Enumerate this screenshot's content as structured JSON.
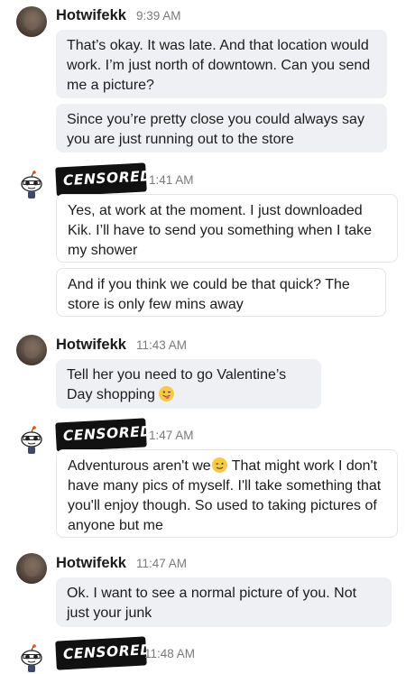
{
  "messages": [
    {
      "sender": "Hotwifekk",
      "time": "9:39 AM",
      "bubbles": [
        "That’s okay. It was late. And that location would work. I’m just north of downtown. Can you send me a picture?",
        "Since you’re pretty close you could always say you are just running out to the store"
      ]
    },
    {
      "sender": "CENSORED",
      "time": "1:41 AM",
      "bubbles": [
        "Yes, at work at the moment. I just downloaded Kik. I’ll have to send you something when I take my shower",
        "And if you think we could be that quick? The store is only few mins away"
      ]
    },
    {
      "sender": "Hotwifekk",
      "time": "11:43 AM",
      "bubbles": [
        "Tell her you need to go Valentine’s Day shopping"
      ]
    },
    {
      "sender": "CENSORED",
      "time": "1:47 AM",
      "bubbles": [
        "Adventurous aren't we",
        "That might work I don't have many pics of myself. I'll take something that you'll enjoy though. So used to taking pictures of anyone but me"
      ]
    },
    {
      "sender": "Hotwifekk",
      "time": "11:47 AM",
      "bubbles": [
        "Ok. I want to see a normal picture of you. Not just your junk"
      ]
    },
    {
      "sender": "CENSORED",
      "time": "11:48 AM",
      "bubbles": []
    }
  ],
  "icons": {
    "photo_avatar": "user-photo-avatar",
    "reddit_avatar": "snoo-avatar",
    "tongue_emoji": "winking-tongue-emoji",
    "wink_emoji": "winking-face-emoji"
  }
}
